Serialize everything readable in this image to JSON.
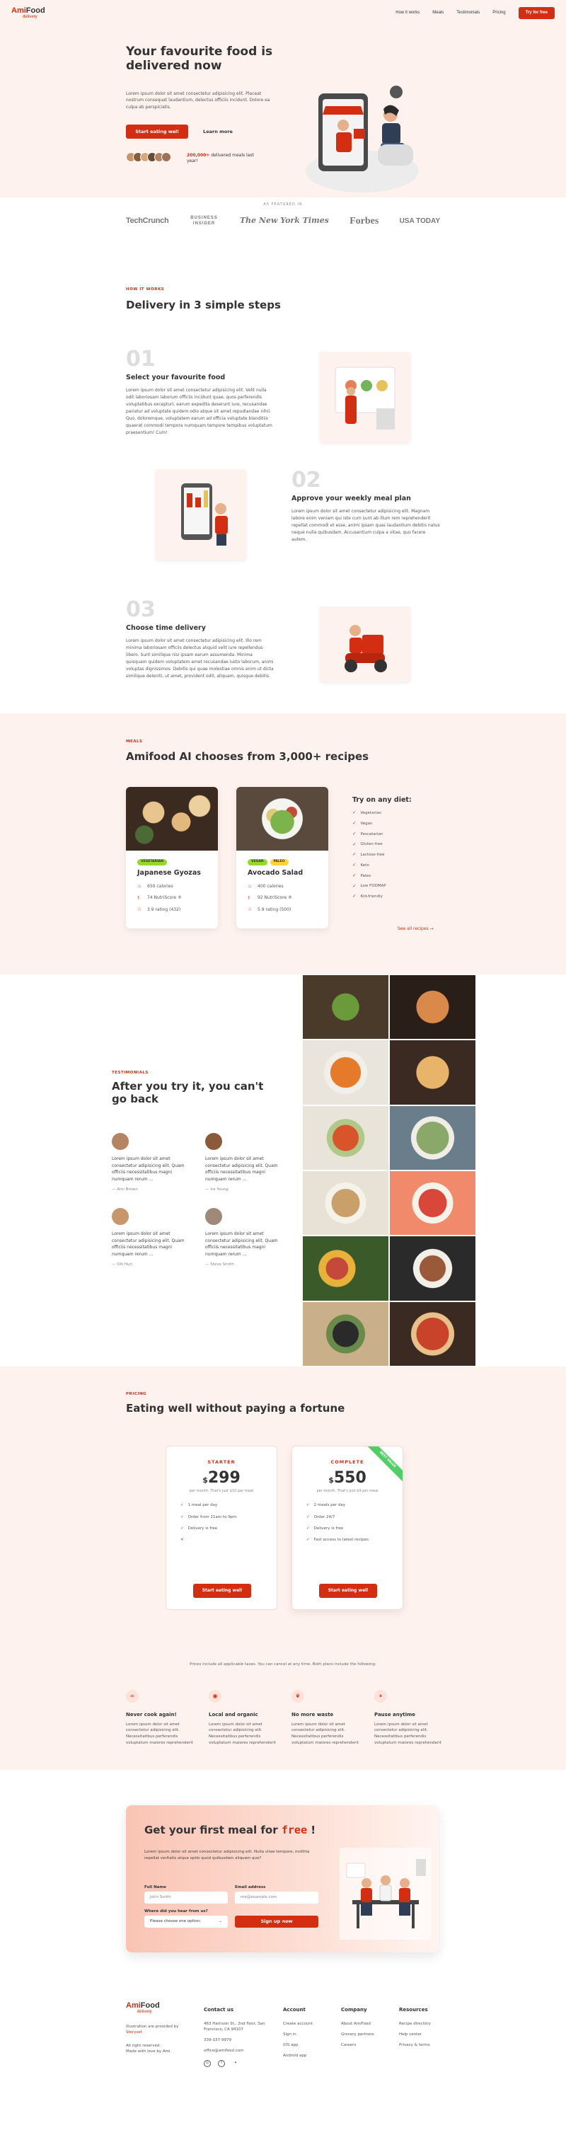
{
  "header": {
    "logo_am": "Ami",
    "logo_food": "Food",
    "logo_sub": "delivery",
    "nav": [
      "How it works",
      "Meals",
      "Testimonials",
      "Pricing"
    ],
    "cta": "Try for free"
  },
  "hero": {
    "title": "Your favourite food is delivered now",
    "description": "Lorem ipsum dolor sit amet consectetur adipisicing elit. Placeat nostrum consequat laudantium, delectus officiis incidunt. Dolore ea culpa ab perspiciatis.",
    "primary_button": "Start eating well",
    "secondary_button": "Learn more",
    "delivered_count": "200,000+",
    "delivered_text": "delivered meals last year!"
  },
  "featured": {
    "label": "AS FEATURED IN",
    "logos": [
      "TechCrunch",
      "BUSINESS INSIDER",
      "The New York Times",
      "Forbes",
      "USA TODAY"
    ]
  },
  "how": {
    "subheading": "HOW IT WORKS",
    "title": "Delivery in 3 simple steps",
    "steps": [
      {
        "num": "01",
        "title": "Select your favourite food",
        "desc": "Lorem ipsum dolor sit amet consectetur adipisicing elit. Velit nulla odit laboriosam laborum officiis incidunt quae, quos perferendis voluptatibus excepturi, earum expedita deserunt iure, recusandae pariatur ad voluptate quidem odio atque sit amet repudiandae nihil. Quo, doloremque, voluptatem earum ad officia voluptate blanditiis quaerat commodi tempora numquam tempore tempibus voluptatum praesentium! Cum!"
      },
      {
        "num": "02",
        "title": "Approve your weekly meal plan",
        "desc": "Lorem ipsum dolor sit amet consectetur adipisicing elit. Magnam labore enim veniam qui iste cum sunt ab illum rem reprehenderit repellat commodi et esse, animi ipsam quas laudantium debitis natus neque nulla quibusdam. Accusantium culpa a vitae, quo facere autem."
      },
      {
        "num": "03",
        "title": "Choose time delivery",
        "desc": "Lorem ipsum dolor sit amet consectetur adipisicing elit. Illo rem minima laboriosam officiis delectus aliquid velit iure repellendus libero. Sunt similique nisi ipsam earum assumenda. Minima quisquam quidem voluptatem amet recusandae iusto laborum, animi voluptas dignissimos. Debitis qui quae molestiae omnis enim ut dicta similique deleniti, ut amet, provident odit, aliquam, quisque debitis."
      }
    ]
  },
  "meals": {
    "subheading": "MEALS",
    "title": "Amifood AI chooses from 3,000+ recipes",
    "cards": [
      {
        "tags": [
          "VEGETARIAN"
        ],
        "name": "Japanese Gyozas",
        "calories": "650 calories",
        "score": "74 NutriScore ®",
        "rating": "3.9 rating (432)"
      },
      {
        "tags": [
          "VEGAN",
          "PALEO"
        ],
        "name": "Avocado Salad",
        "calories": "400 calories",
        "score": "92 NutriScore ®",
        "rating": "5.9 rating (500)"
      }
    ],
    "diet_title": "Try on any diet:",
    "diets": [
      "Vegetarian",
      "Vegan",
      "Pescatarian",
      "Gluten-free",
      "Lactose-free",
      "Keto",
      "Paleo",
      "Low FODMAP",
      "Kid-friendly"
    ],
    "see_all": "See all recipes →"
  },
  "testimonials": {
    "subheading": "TESTIMONIALS",
    "title": "After you try it, you can't go back",
    "items": [
      {
        "text": "Lorem ipsum dolor sit amet consectetur adipisicing elit. Quam officiis necessitatibus magni numquam rerum ...",
        "name": "— Ami Brown"
      },
      {
        "text": "Lorem ipsum dolor sit amet consectetur adipisicing elit. Quam officiis necessitatibus magni numquam rerum ...",
        "name": "— Ira Young"
      },
      {
        "text": "Lorem ipsum dolor sit amet consectetur adipisicing elit. Quam officiis necessitatibus magni numquam rerum ...",
        "name": "— Olli Hun"
      },
      {
        "text": "Lorem ipsum dolor sit amet consectetur adipisicing elit. Quam officiis necessitatibus magni numquam rerum ...",
        "name": "— Steve Smith"
      }
    ]
  },
  "pricing": {
    "subheading": "PRICING",
    "title": "Eating well without paying a fortune",
    "plans": [
      {
        "name": "STARTER",
        "currency": "$",
        "price": "299",
        "note": "per month. That's just $10 per meal",
        "features": [
          "1 meal per day",
          "Order from 11am to 9pm",
          "Delivery is free",
          ""
        ],
        "button": "Start eating well"
      },
      {
        "name": "COMPLETE",
        "currency": "$",
        "price": "550",
        "note": "per month. That's just $9 per meal",
        "features": [
          "2 meals per day",
          "Order 24/7",
          "Delivery is free",
          "Fast access to latest recipes"
        ],
        "button": "Start eating well",
        "ribbon": "BEST VALUE"
      }
    ],
    "footnote": "Prices include all applicable taxes. You can cancel at any time. Both plans include the following:",
    "features": [
      {
        "title": "Never cook again!",
        "desc": "Lorem ipsum dolor sit amet consectetur adipisicing elit. Necessitatibus perferendis voluptatum maiores reprehenderit"
      },
      {
        "title": "Local and organic",
        "desc": "Lorem ipsum dolor sit amet consectetur adipisicing elit. Necessitatibus perferendis voluptatum maiores reprehenderit"
      },
      {
        "title": "No more waste",
        "desc": "Lorem ipsum dolor sit amet consectetur adipisicing elit. Necessitatibus perferendis voluptatum maiores reprehenderit"
      },
      {
        "title": "Pause anytime",
        "desc": "Lorem ipsum dolor sit amet consectetur adipisicing elit. Necessitatibus perferendis voluptatum maiores reprehenderit"
      }
    ]
  },
  "cta": {
    "title_pre": "Get your first meal for",
    "title_free": "free",
    "title_post": "!",
    "desc": "Lorem ipsum dolor sit amet consectetur adipisicing elit. Nulla vitae tempore, mollitia repellat veritatis atque optio quod quibusdam aliquam quo?",
    "full_name_label": "Full Name",
    "full_name_placeholder": "John Smith",
    "email_label": "Email address",
    "email_placeholder": "me@example.com",
    "where_label": "Where did you hear from us?",
    "select_value": "Please choose one option:",
    "submit": "Sign up now"
  },
  "footer": {
    "credit_line1": "Illustration are provided by",
    "credit_link": "Storyset",
    "rights": "All right reserved.",
    "made": "Made with love by Ami.",
    "contact_title": "Contact us",
    "address": "463 Harrison St., 2nd floor, San Francisco, CA 94107",
    "phone": "339-337-9979",
    "email": "office@amifood.com",
    "account_title": "Account",
    "account": [
      "Create account",
      "Sign in",
      "iOS app",
      "Android app"
    ],
    "company_title": "Company",
    "company": [
      "About AmiFood",
      "Grocery partners",
      "Careers"
    ],
    "resources_title": "Resources",
    "resources": [
      "Recipe directory",
      "Help center",
      "Privacy & terms"
    ]
  },
  "colors": {
    "accent": "#d42e12",
    "bg_tint": "#fef2ee"
  }
}
